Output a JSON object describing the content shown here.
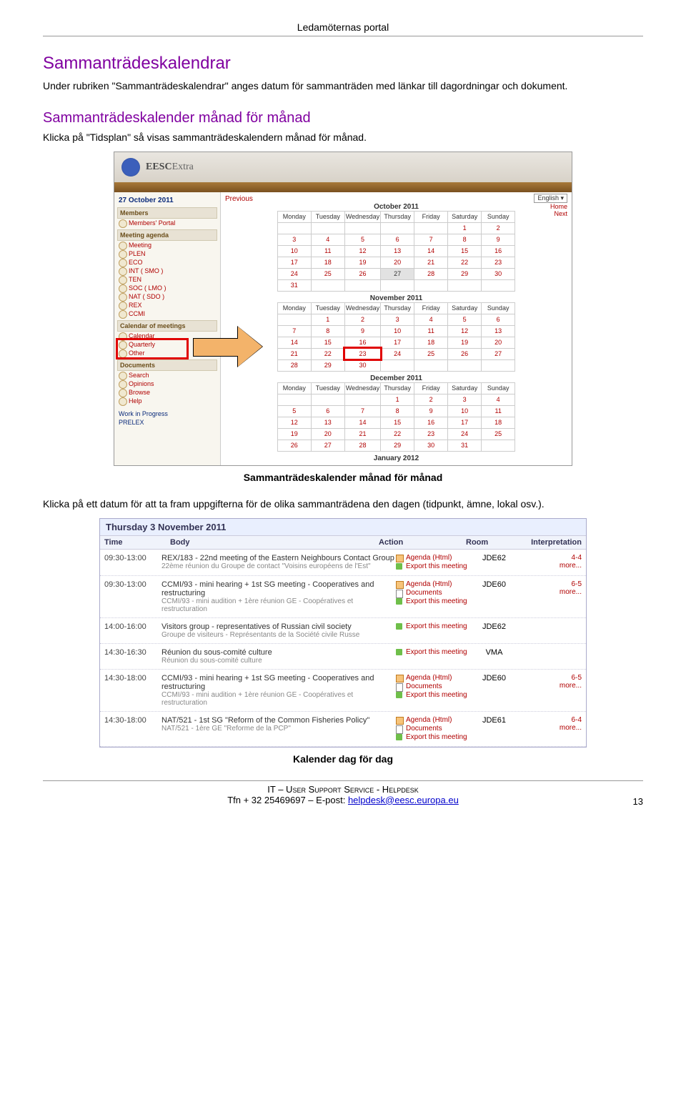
{
  "header": {
    "title": "Ledamöternas portal"
  },
  "sections": {
    "title1": "Sammanträdeskalendrar",
    "para1": "Under rubriken \"Sammanträdeskalendrar\" anges datum för sammanträden med länkar till dagordningar och dokument.",
    "title2": "Sammanträdeskalender månad för månad",
    "para2": "Klicka på \"Tidsplan\" så visas sammanträdeskalendern månad för månad.",
    "caption1": "Sammanträdeskalender månad för månad",
    "para3": "Klicka på ett datum för att ta fram uppgifterna för de olika sammanträdena den dagen (tidpunkt, ämne, lokal osv.).",
    "caption2": "Kalender dag för dag"
  },
  "shot1": {
    "brand_prefix": "EESC",
    "brand_suffix": "Extra",
    "date": "27 October 2011",
    "lang": "English",
    "nav_home": "Home",
    "nav_next": "Next",
    "nav_prev": "Previous",
    "groups": {
      "members": "Members",
      "agenda": "Meeting agenda",
      "calendar": "Calendar of meetings",
      "documents": "Documents"
    },
    "members_items": [
      "Members' Portal"
    ],
    "agenda_items": [
      "Meeting",
      "PLEN",
      "ECO",
      "INT  ( SMO )",
      "TEN",
      "SOC  ( LMO )",
      "NAT  ( SDO )",
      "REX",
      "CCMI"
    ],
    "calendar_items": [
      "Calendar",
      "Quarterly",
      "Other"
    ],
    "documents_items": [
      "Search",
      "Opinions",
      "Browse",
      "Help"
    ],
    "bottom_links": [
      "Work in Progress",
      "PRELEX"
    ],
    "months": {
      "oct": "October 2011",
      "nov": "November 2011",
      "dec": "December 2011",
      "jan": "January 2012"
    },
    "weekdays": [
      "Monday",
      "Tuesday",
      "Wednesday",
      "Thursday",
      "Friday",
      "Saturday",
      "Sunday"
    ]
  },
  "chart_data": {
    "type": "table",
    "title": "Monthly meeting calendars (EESCExtra portal)",
    "weekdays": [
      "Monday",
      "Tuesday",
      "Wednesday",
      "Thursday",
      "Friday",
      "Saturday",
      "Sunday"
    ],
    "months": [
      {
        "name": "October 2011",
        "rows": [
          [
            "",
            "",
            "",
            "",
            "",
            "1",
            "2"
          ],
          [
            "3",
            "4",
            "5",
            "6",
            "7",
            "8",
            "9"
          ],
          [
            "10",
            "11",
            "12",
            "13",
            "14",
            "15",
            "16"
          ],
          [
            "17",
            "18",
            "19",
            "20",
            "21",
            "22",
            "23"
          ],
          [
            "24",
            "25",
            "26",
            "27",
            "28",
            "29",
            "30"
          ],
          [
            "31",
            "",
            "",
            "",
            "",
            "",
            ""
          ]
        ],
        "today": "27"
      },
      {
        "name": "November 2011",
        "rows": [
          [
            "",
            "1",
            "2",
            "3",
            "4",
            "5",
            "6"
          ],
          [
            "7",
            "8",
            "9",
            "10",
            "11",
            "12",
            "13"
          ],
          [
            "14",
            "15",
            "16",
            "17",
            "18",
            "19",
            "20"
          ],
          [
            "21",
            "22",
            "23",
            "24",
            "25",
            "26",
            "27"
          ],
          [
            "28",
            "29",
            "30",
            "",
            "",
            "",
            ""
          ]
        ],
        "highlight": "23"
      },
      {
        "name": "December 2011",
        "rows": [
          [
            "",
            "",
            "",
            "1",
            "2",
            "3",
            "4"
          ],
          [
            "5",
            "6",
            "7",
            "8",
            "9",
            "10",
            "11"
          ],
          [
            "12",
            "13",
            "14",
            "15",
            "16",
            "17",
            "18"
          ],
          [
            "19",
            "20",
            "21",
            "22",
            "23",
            "24",
            "25"
          ],
          [
            "26",
            "27",
            "28",
            "29",
            "30",
            "31",
            ""
          ]
        ]
      }
    ],
    "next_month_label": "January 2012"
  },
  "shot2": {
    "heading": "Thursday 3 November 2011",
    "cols": {
      "time": "Time",
      "body": "Body",
      "action": "Action",
      "room": "Room",
      "interp": "Interpretation"
    },
    "actions": {
      "agenda": "Agenda (Html)",
      "docs": "Documents",
      "export": "Export this meeting",
      "more": "more..."
    },
    "rows": [
      {
        "time": "09:30-13:00",
        "body1": "REX/183 - 22nd meeting of the Eastern Neighbours Contact Group",
        "body2": "22ème réunion du Groupe de contact \"Voisins européens de l'Est\"",
        "acts": [
          "agenda",
          "export"
        ],
        "room": "JDE62",
        "int": "4-4"
      },
      {
        "time": "09:30-13:00",
        "body1": "CCMI/93 - mini hearing + 1st SG meeting - Cooperatives and restructuring",
        "body2": "CCMI/93 - mini audition + 1ère réunion GE - Coopératives et restructuration",
        "acts": [
          "agenda",
          "docs",
          "export"
        ],
        "room": "JDE60",
        "int": "6-5"
      },
      {
        "time": "14:00-16:00",
        "body1": "Visitors group - representatives of Russian civil society",
        "body2": "Groupe de visiteurs - Représentants de la Société civile Russe",
        "acts": [
          "export"
        ],
        "room": "JDE62",
        "int": ""
      },
      {
        "time": "14:30-16:30",
        "body1": "Réunion du sous-comité culture",
        "body2": "Réunion du sous-comité culture",
        "acts": [
          "export"
        ],
        "room": "VMA",
        "int": ""
      },
      {
        "time": "14:30-18:00",
        "body1": "CCMI/93 - mini hearing + 1st SG meeting - Cooperatives and restructuring",
        "body2": "CCMI/93 - mini audition + 1ère réunion GE - Coopératives et restructuration",
        "acts": [
          "agenda",
          "docs",
          "export"
        ],
        "room": "JDE60",
        "int": "6-5"
      },
      {
        "time": "14:30-18:00",
        "body1": "NAT/521 - 1st SG \"Reform of the Common Fisheries Policy\"",
        "body2": "NAT/521 - 1ère GE \"Reforme de la PCP\"",
        "acts": [
          "agenda",
          "docs",
          "export"
        ],
        "room": "JDE61",
        "int": "6-4"
      }
    ]
  },
  "footer": {
    "line1_a": "IT – U",
    "line1_b": "ser ",
    "line1_c": "S",
    "line1_d": "upport ",
    "line1_e": "S",
    "line1_f": "ervice",
    "line1_g": " - H",
    "line1_h": "elpdesk",
    "line2_prefix": "Tfn + 32 25469697 – E-post: ",
    "email": "helpdesk@eesc.europa.eu",
    "pagenum": "13"
  }
}
